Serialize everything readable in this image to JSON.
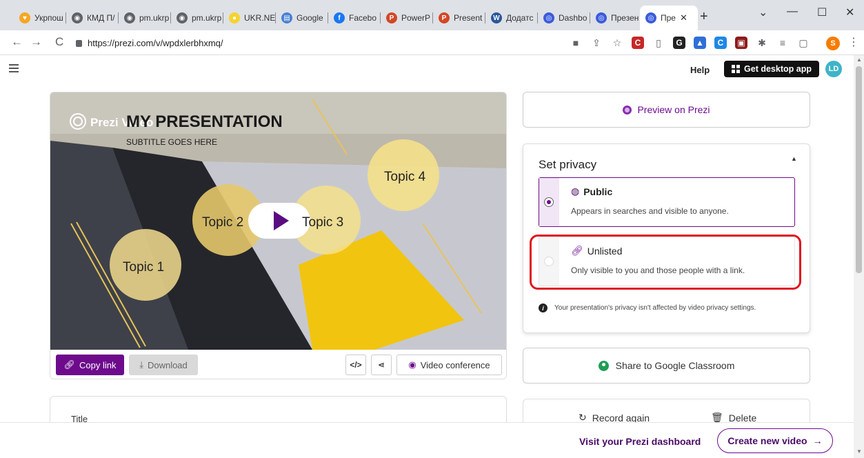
{
  "browser": {
    "tabs": [
      {
        "label": "Укрпош",
        "color": "#f5a623",
        "glyph": "♥"
      },
      {
        "label": "КМД П/",
        "color": "#5f6368",
        "glyph": "◉"
      },
      {
        "label": "pm.ukrp",
        "color": "#5f6368",
        "glyph": "◉"
      },
      {
        "label": "pm.ukrp",
        "color": "#5f6368",
        "glyph": "◉"
      },
      {
        "label": "UKR.NE",
        "color": "#f6d32d",
        "glyph": "●"
      },
      {
        "label": "Google",
        "color": "#4a7fd4",
        "glyph": "▤"
      },
      {
        "label": "Facebo",
        "color": "#1877f2",
        "glyph": "f"
      },
      {
        "label": "PowerP",
        "color": "#d24726",
        "glyph": "P"
      },
      {
        "label": "Present",
        "color": "#d24726",
        "glyph": "P"
      },
      {
        "label": "Додатс",
        "color": "#2b579a",
        "glyph": "W"
      },
      {
        "label": "Dashbo",
        "color": "#3b5bdb",
        "glyph": "◎"
      },
      {
        "label": "Презен",
        "color": "#3b5bdb",
        "glyph": "◎"
      }
    ],
    "active_tab": {
      "label": "Пре",
      "close": "✕"
    },
    "new_tab": "+",
    "window_controls": {
      "minimize": "—",
      "maximize": "☐",
      "close": "✕",
      "dropdown": "⌄"
    },
    "url": "https://prezi.com/v/wpdxlerbhxmq/",
    "profile_letter": "S"
  },
  "header": {
    "help": "Help",
    "get_app": "Get desktop app",
    "avatar": "LD"
  },
  "video": {
    "brand": "Prezi Video",
    "slide_title": "MY PRESENTATION",
    "slide_subtitle": "SUBTITLE GOES HERE",
    "topics": [
      "Topic 1",
      "Topic 2",
      "Topic 3",
      "Topic 4"
    ],
    "copy_link": "Copy link",
    "download": "Download",
    "embed_icon": "</>",
    "video_conference": "Video conference"
  },
  "title_card": {
    "label": "Title"
  },
  "right": {
    "preview": "Preview on Prezi",
    "privacy": {
      "title": "Set privacy",
      "options": [
        {
          "name": "Public",
          "desc": "Appears in searches and visible to anyone."
        },
        {
          "name": "Unlisted",
          "desc": "Only visible to you and those people with a link."
        }
      ],
      "selected": "Public",
      "note": "Your presentation's privacy isn't affected by video privacy settings."
    },
    "classroom": "Share to Google Classroom",
    "record_again": "Record again",
    "delete": "Delete"
  },
  "footer": {
    "dashboard": "Visit your Prezi dashboard",
    "create": "Create new video",
    "arrow": "→"
  },
  "colors": {
    "brand_purple": "#6d0b8c",
    "highlight_red": "#e0141e"
  }
}
